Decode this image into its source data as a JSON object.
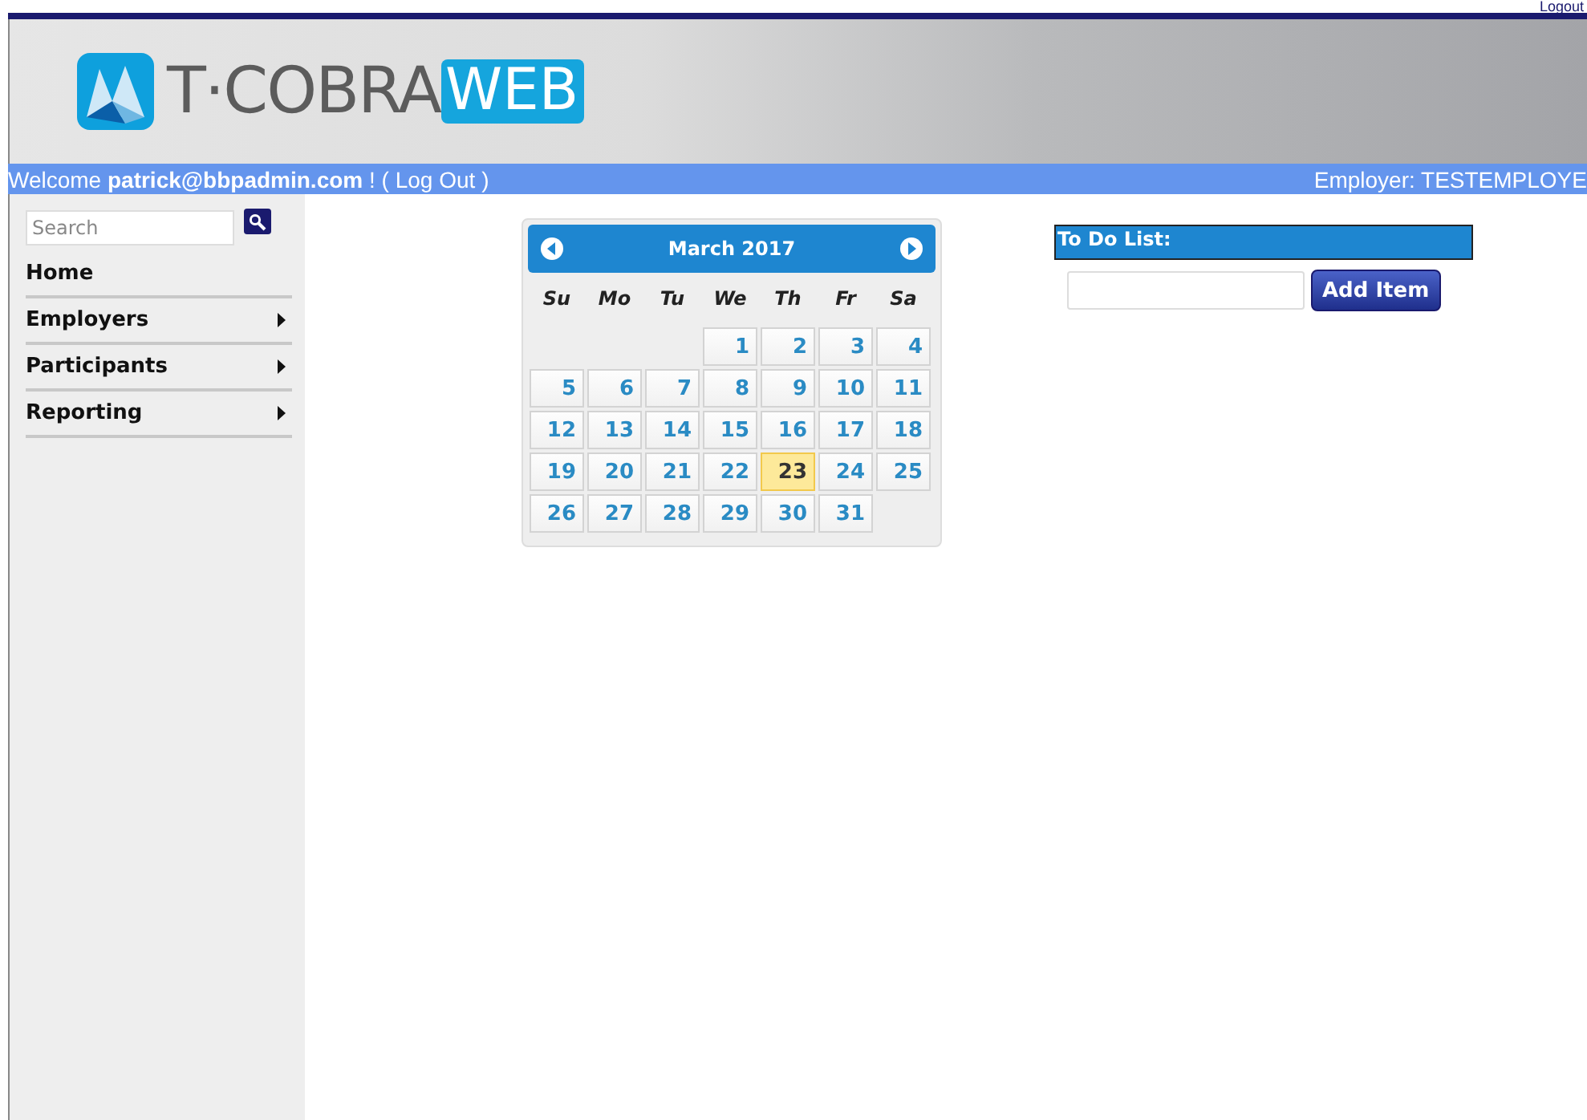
{
  "top_bar": {
    "link": "Logout"
  },
  "logo": {
    "name": "T·COBRA",
    "tag": "WEB"
  },
  "welcome_bar": {
    "greeting": "Welcome",
    "user": "patrick@bbpadmin.com",
    "suffix": "! (",
    "logout": "Log Out",
    "close": ")",
    "employer": "Employer: TESTEMPLOYE"
  },
  "sidebar": {
    "search": {
      "placeholder": "Search"
    },
    "items": [
      {
        "label": "Home",
        "has_submenu": false
      },
      {
        "label": "Employers",
        "has_submenu": true
      },
      {
        "label": "Participants",
        "has_submenu": true
      },
      {
        "label": "Reporting",
        "has_submenu": true
      }
    ]
  },
  "calendar": {
    "title": "March 2017",
    "weekdays": [
      "Su",
      "Mo",
      "Tu",
      "We",
      "Th",
      "Fr",
      "Sa"
    ],
    "weeks": [
      {
        "days": [
          {
            "day": "1",
            "selected": false
          },
          {
            "day": "2",
            "selected": false
          },
          {
            "day": "3",
            "selected": false
          },
          {
            "day": "4",
            "selected": false
          }
        ]
      },
      {
        "days": [
          {
            "day": "5",
            "selected": false
          },
          {
            "day": "6",
            "selected": false
          },
          {
            "day": "7",
            "selected": false
          },
          {
            "day": "8",
            "selected": false
          },
          {
            "day": "9",
            "selected": false
          },
          {
            "day": "10",
            "selected": false
          },
          {
            "day": "11",
            "selected": false
          }
        ]
      },
      {
        "days": [
          {
            "day": "12",
            "selected": false
          },
          {
            "day": "13",
            "selected": false
          },
          {
            "day": "14",
            "selected": false
          },
          {
            "day": "15",
            "selected": false
          },
          {
            "day": "16",
            "selected": false
          },
          {
            "day": "17",
            "selected": false
          },
          {
            "day": "18",
            "selected": false
          }
        ]
      },
      {
        "days": [
          {
            "day": "19",
            "selected": false
          },
          {
            "day": "20",
            "selected": false
          },
          {
            "day": "21",
            "selected": false
          },
          {
            "day": "22",
            "selected": false
          },
          {
            "day": "23",
            "selected": true
          },
          {
            "day": "24",
            "selected": false
          },
          {
            "day": "25",
            "selected": false
          }
        ]
      },
      {
        "days": [
          {
            "day": "26",
            "selected": false
          },
          {
            "day": "27",
            "selected": false
          },
          {
            "day": "28",
            "selected": false
          },
          {
            "day": "29",
            "selected": false
          },
          {
            "day": "30",
            "selected": false
          },
          {
            "day": "31",
            "selected": false
          }
        ]
      }
    ]
  },
  "todo": {
    "title": "To Do List:",
    "button": "Add Item"
  }
}
